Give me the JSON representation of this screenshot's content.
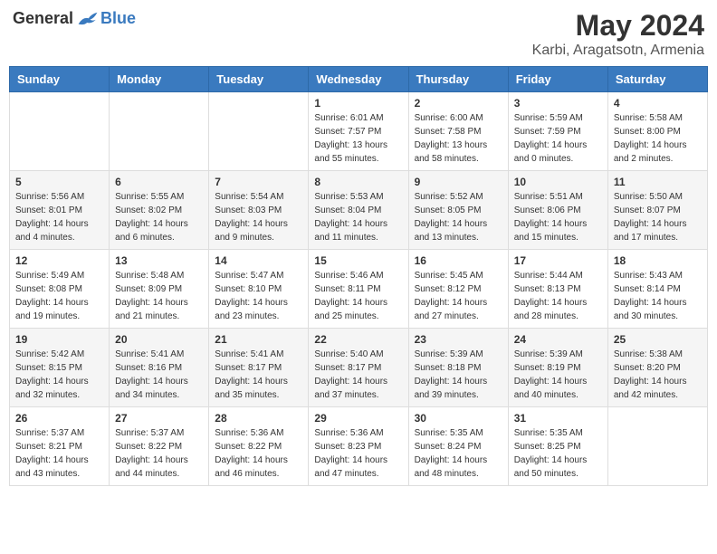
{
  "header": {
    "logo_general": "General",
    "logo_blue": "Blue",
    "month_title": "May 2024",
    "location": "Karbi, Aragatsotn, Armenia"
  },
  "days_of_week": [
    "Sunday",
    "Monday",
    "Tuesday",
    "Wednesday",
    "Thursday",
    "Friday",
    "Saturday"
  ],
  "weeks": [
    [
      {
        "day": "",
        "sunrise": "",
        "sunset": "",
        "daylight": ""
      },
      {
        "day": "",
        "sunrise": "",
        "sunset": "",
        "daylight": ""
      },
      {
        "day": "",
        "sunrise": "",
        "sunset": "",
        "daylight": ""
      },
      {
        "day": "1",
        "sunrise": "Sunrise: 6:01 AM",
        "sunset": "Sunset: 7:57 PM",
        "daylight": "Daylight: 13 hours and 55 minutes."
      },
      {
        "day": "2",
        "sunrise": "Sunrise: 6:00 AM",
        "sunset": "Sunset: 7:58 PM",
        "daylight": "Daylight: 13 hours and 58 minutes."
      },
      {
        "day": "3",
        "sunrise": "Sunrise: 5:59 AM",
        "sunset": "Sunset: 7:59 PM",
        "daylight": "Daylight: 14 hours and 0 minutes."
      },
      {
        "day": "4",
        "sunrise": "Sunrise: 5:58 AM",
        "sunset": "Sunset: 8:00 PM",
        "daylight": "Daylight: 14 hours and 2 minutes."
      }
    ],
    [
      {
        "day": "5",
        "sunrise": "Sunrise: 5:56 AM",
        "sunset": "Sunset: 8:01 PM",
        "daylight": "Daylight: 14 hours and 4 minutes."
      },
      {
        "day": "6",
        "sunrise": "Sunrise: 5:55 AM",
        "sunset": "Sunset: 8:02 PM",
        "daylight": "Daylight: 14 hours and 6 minutes."
      },
      {
        "day": "7",
        "sunrise": "Sunrise: 5:54 AM",
        "sunset": "Sunset: 8:03 PM",
        "daylight": "Daylight: 14 hours and 9 minutes."
      },
      {
        "day": "8",
        "sunrise": "Sunrise: 5:53 AM",
        "sunset": "Sunset: 8:04 PM",
        "daylight": "Daylight: 14 hours and 11 minutes."
      },
      {
        "day": "9",
        "sunrise": "Sunrise: 5:52 AM",
        "sunset": "Sunset: 8:05 PM",
        "daylight": "Daylight: 14 hours and 13 minutes."
      },
      {
        "day": "10",
        "sunrise": "Sunrise: 5:51 AM",
        "sunset": "Sunset: 8:06 PM",
        "daylight": "Daylight: 14 hours and 15 minutes."
      },
      {
        "day": "11",
        "sunrise": "Sunrise: 5:50 AM",
        "sunset": "Sunset: 8:07 PM",
        "daylight": "Daylight: 14 hours and 17 minutes."
      }
    ],
    [
      {
        "day": "12",
        "sunrise": "Sunrise: 5:49 AM",
        "sunset": "Sunset: 8:08 PM",
        "daylight": "Daylight: 14 hours and 19 minutes."
      },
      {
        "day": "13",
        "sunrise": "Sunrise: 5:48 AM",
        "sunset": "Sunset: 8:09 PM",
        "daylight": "Daylight: 14 hours and 21 minutes."
      },
      {
        "day": "14",
        "sunrise": "Sunrise: 5:47 AM",
        "sunset": "Sunset: 8:10 PM",
        "daylight": "Daylight: 14 hours and 23 minutes."
      },
      {
        "day": "15",
        "sunrise": "Sunrise: 5:46 AM",
        "sunset": "Sunset: 8:11 PM",
        "daylight": "Daylight: 14 hours and 25 minutes."
      },
      {
        "day": "16",
        "sunrise": "Sunrise: 5:45 AM",
        "sunset": "Sunset: 8:12 PM",
        "daylight": "Daylight: 14 hours and 27 minutes."
      },
      {
        "day": "17",
        "sunrise": "Sunrise: 5:44 AM",
        "sunset": "Sunset: 8:13 PM",
        "daylight": "Daylight: 14 hours and 28 minutes."
      },
      {
        "day": "18",
        "sunrise": "Sunrise: 5:43 AM",
        "sunset": "Sunset: 8:14 PM",
        "daylight": "Daylight: 14 hours and 30 minutes."
      }
    ],
    [
      {
        "day": "19",
        "sunrise": "Sunrise: 5:42 AM",
        "sunset": "Sunset: 8:15 PM",
        "daylight": "Daylight: 14 hours and 32 minutes."
      },
      {
        "day": "20",
        "sunrise": "Sunrise: 5:41 AM",
        "sunset": "Sunset: 8:16 PM",
        "daylight": "Daylight: 14 hours and 34 minutes."
      },
      {
        "day": "21",
        "sunrise": "Sunrise: 5:41 AM",
        "sunset": "Sunset: 8:17 PM",
        "daylight": "Daylight: 14 hours and 35 minutes."
      },
      {
        "day": "22",
        "sunrise": "Sunrise: 5:40 AM",
        "sunset": "Sunset: 8:17 PM",
        "daylight": "Daylight: 14 hours and 37 minutes."
      },
      {
        "day": "23",
        "sunrise": "Sunrise: 5:39 AM",
        "sunset": "Sunset: 8:18 PM",
        "daylight": "Daylight: 14 hours and 39 minutes."
      },
      {
        "day": "24",
        "sunrise": "Sunrise: 5:39 AM",
        "sunset": "Sunset: 8:19 PM",
        "daylight": "Daylight: 14 hours and 40 minutes."
      },
      {
        "day": "25",
        "sunrise": "Sunrise: 5:38 AM",
        "sunset": "Sunset: 8:20 PM",
        "daylight": "Daylight: 14 hours and 42 minutes."
      }
    ],
    [
      {
        "day": "26",
        "sunrise": "Sunrise: 5:37 AM",
        "sunset": "Sunset: 8:21 PM",
        "daylight": "Daylight: 14 hours and 43 minutes."
      },
      {
        "day": "27",
        "sunrise": "Sunrise: 5:37 AM",
        "sunset": "Sunset: 8:22 PM",
        "daylight": "Daylight: 14 hours and 44 minutes."
      },
      {
        "day": "28",
        "sunrise": "Sunrise: 5:36 AM",
        "sunset": "Sunset: 8:22 PM",
        "daylight": "Daylight: 14 hours and 46 minutes."
      },
      {
        "day": "29",
        "sunrise": "Sunrise: 5:36 AM",
        "sunset": "Sunset: 8:23 PM",
        "daylight": "Daylight: 14 hours and 47 minutes."
      },
      {
        "day": "30",
        "sunrise": "Sunrise: 5:35 AM",
        "sunset": "Sunset: 8:24 PM",
        "daylight": "Daylight: 14 hours and 48 minutes."
      },
      {
        "day": "31",
        "sunrise": "Sunrise: 5:35 AM",
        "sunset": "Sunset: 8:25 PM",
        "daylight": "Daylight: 14 hours and 50 minutes."
      },
      {
        "day": "",
        "sunrise": "",
        "sunset": "",
        "daylight": ""
      }
    ]
  ]
}
